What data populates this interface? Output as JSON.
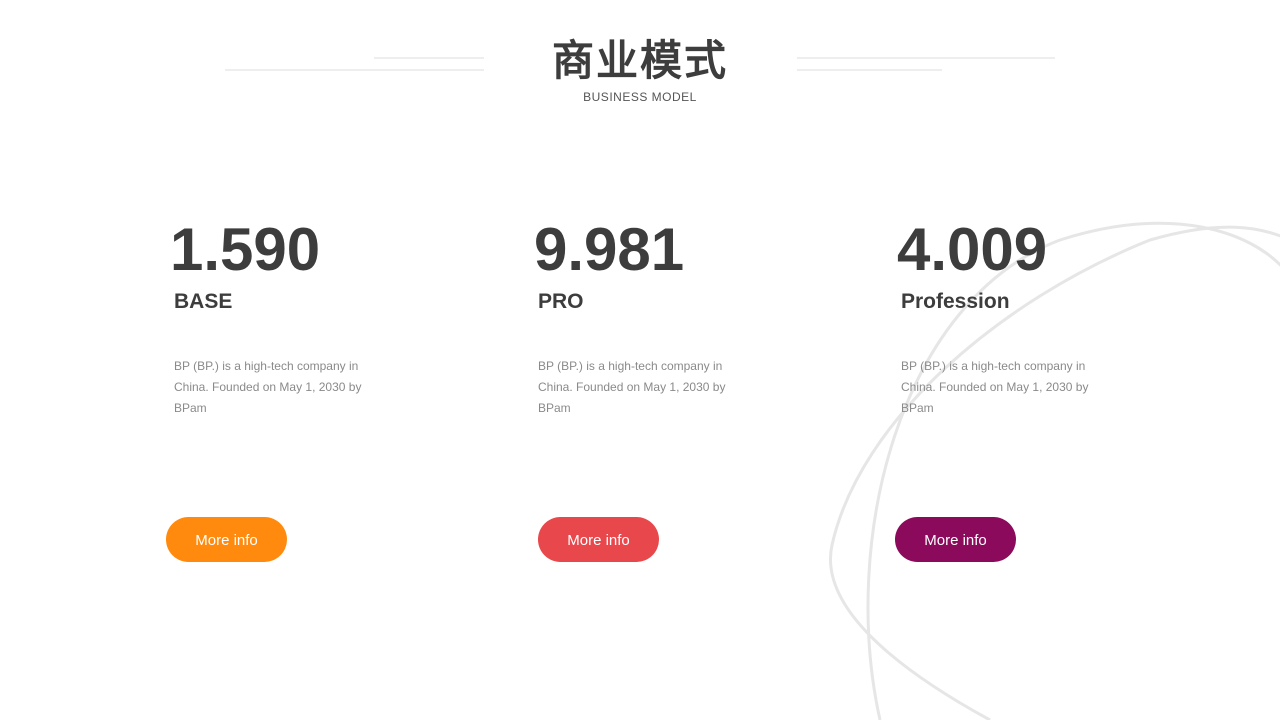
{
  "header": {
    "title": "商业模式",
    "subtitle": "BUSINESS  MODEL"
  },
  "plans": [
    {
      "value": "1.590",
      "name": "BASE",
      "description": "BP (BP.) is a high-tech company in China. Founded on May  1, 2030 by BPam",
      "button_label": "More info",
      "button_color": "#FF8A0D"
    },
    {
      "value": "9.981",
      "name": "PRO",
      "description": "BP (BP.) is a high-tech company in China. Founded on May  1, 2030 by BPam",
      "button_label": "More info",
      "button_color": "#E8474B"
    },
    {
      "value": "4.009",
      "name": "Profession",
      "description": "BP (BP.) is a high-tech company in China. Founded on May  1, 2030 by BPam",
      "button_label": "More info",
      "button_color": "#8B0A5C"
    }
  ]
}
